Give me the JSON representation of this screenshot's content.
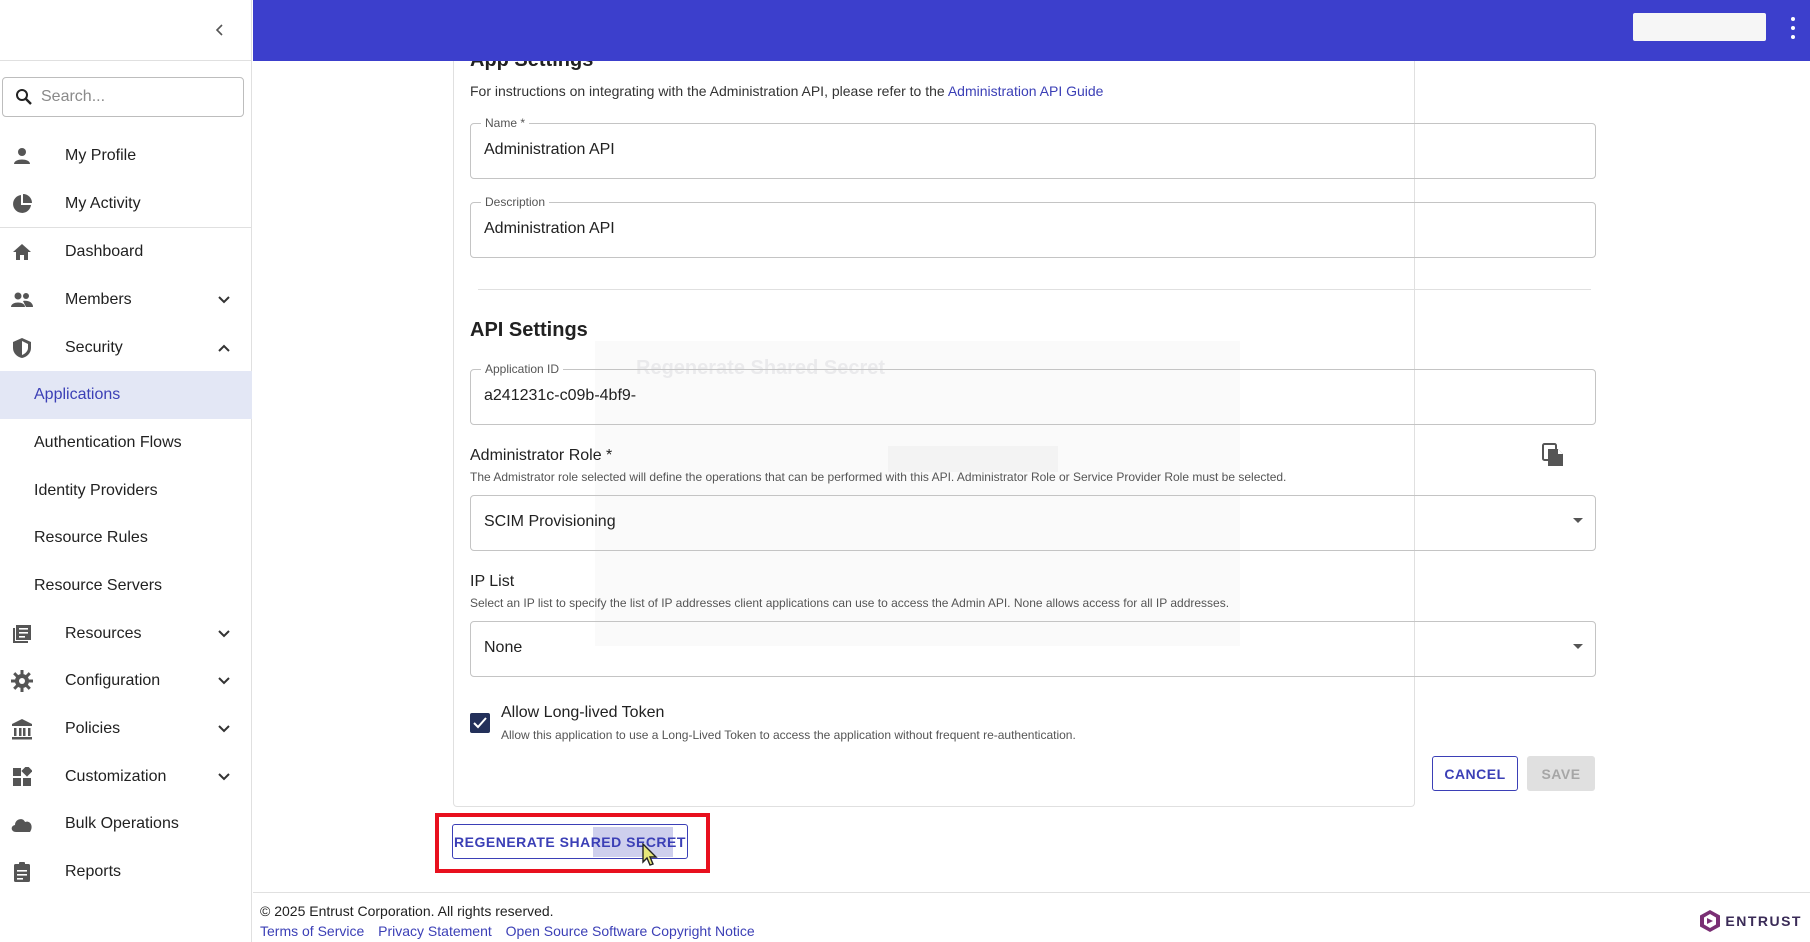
{
  "sidebar": {
    "search_placeholder": "Search...",
    "items": [
      {
        "label": "My Profile",
        "icon": "person-icon"
      },
      {
        "label": "My Activity",
        "icon": "pie-chart-icon"
      },
      {
        "label": "Dashboard",
        "icon": "home-icon"
      },
      {
        "label": "Members",
        "icon": "people-icon"
      },
      {
        "label": "Security",
        "icon": "shield-icon"
      },
      {
        "label": "Applications"
      },
      {
        "label": "Authentication Flows"
      },
      {
        "label": "Identity Providers"
      },
      {
        "label": "Resource Rules"
      },
      {
        "label": "Resource Servers"
      },
      {
        "label": "Resources",
        "icon": "book-icon"
      },
      {
        "label": "Configuration",
        "icon": "gear-icon"
      },
      {
        "label": "Policies",
        "icon": "bank-icon"
      },
      {
        "label": "Customization",
        "icon": "dashboard-tiles-icon"
      },
      {
        "label": "Bulk Operations",
        "icon": "cloud-icon"
      },
      {
        "label": "Reports",
        "icon": "clipboard-icon"
      }
    ]
  },
  "main": {
    "app_settings_heading": "App Settings",
    "intro_text": "For instructions on integrating with the Administration API, please refer to the",
    "intro_link": "Administration API Guide",
    "name_label": "Name *",
    "name_value": "Administration API",
    "description_label": "Description",
    "description_value": "Administration API",
    "api_settings_heading": "API Settings",
    "application_id_label": "Application ID",
    "application_id_value": "a241231c-c09b-4bf9-",
    "admin_role_title": "Administrator Role *",
    "admin_role_help": "The Admistrator role selected will define the operations that can be performed with this API. Administrator Role or Service Provider Role must be selected.",
    "admin_role_value": "SCIM Provisioning",
    "ip_list_title": "IP List",
    "ip_list_help": "Select an IP list to specify the list of IP addresses client applications can use to access the Admin API. None allows access for all IP addresses.",
    "ip_list_value": "None",
    "long_lived_label": "Allow Long-lived Token",
    "long_lived_help": "Allow this application to use a Long-Lived Token to access the application without frequent re-authentication.",
    "long_lived_checked": true,
    "cancel_label": "CANCEL",
    "save_label": "SAVE",
    "regenerate_label": "REGENERATE SHARED SECRET",
    "ghost_modal_title": "Regenerate Shared Secret"
  },
  "footer": {
    "copyright": "© 2025 Entrust Corporation. All rights reserved.",
    "links": [
      "Terms of Service",
      "Privacy Statement",
      "Open Source Software Copyright Notice"
    ],
    "brand": "ENTRUST"
  },
  "colors": {
    "topbar": "#3c3fcc",
    "accent": "#3b3fb6",
    "active_bg": "#e3e7f5",
    "highlight": "#e8101e"
  }
}
